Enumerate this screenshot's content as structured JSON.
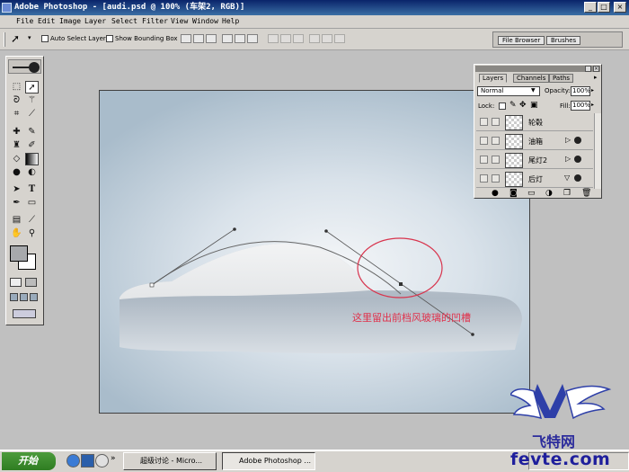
{
  "window": {
    "title": "Adobe Photoshop - [audi.psd @ 100% (车架2, RGB)]",
    "controls": [
      "_",
      "□",
      "×"
    ]
  },
  "menu": [
    "File",
    "Edit",
    "Image",
    "Layer",
    "Select",
    "Filter",
    "View",
    "Window",
    "Help"
  ],
  "options": {
    "auto_select": "Auto Select Layer",
    "show_bounding": "Show Bounding Box"
  },
  "palette_well": {
    "tabs": [
      "File Browser",
      "Brushes"
    ]
  },
  "layers_panel": {
    "tabs": [
      "Layers",
      "Channels",
      "Paths"
    ],
    "blend_mode": "Normal",
    "opacity_label": "Opacity:",
    "opacity": "100%",
    "lock_label": "Lock:",
    "fill_label": "Fill:",
    "fill": "100%",
    "layers": [
      {
        "name": "轮毂"
      },
      {
        "name": "油箱"
      },
      {
        "name": "尾灯2"
      },
      {
        "name": "后灯"
      }
    ]
  },
  "canvas": {
    "annotation": "这里留出前档风玻璃的凹槽",
    "annotation_color": "#e0304a"
  },
  "taskbar": {
    "start": "开始",
    "buttons": [
      "超级讨论 - Micro...",
      "Adobe Photoshop ..."
    ]
  },
  "watermark": {
    "top": "飞特网",
    "bottom": "fevte.com"
  }
}
